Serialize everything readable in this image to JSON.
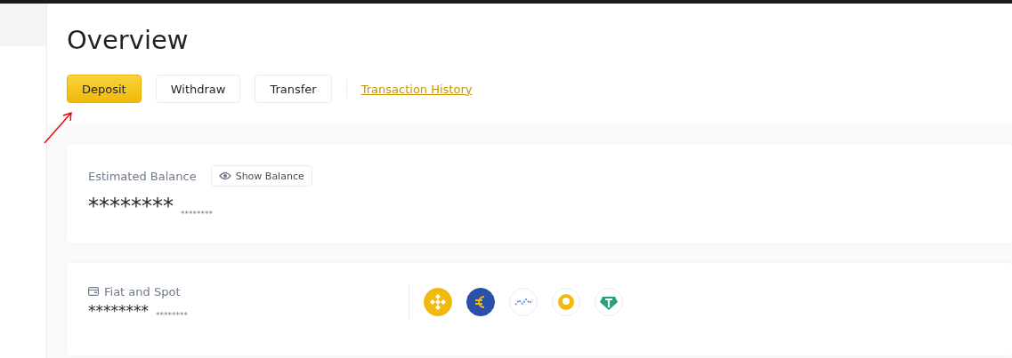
{
  "title": "Overview",
  "actions": [
    {
      "label": "Deposit",
      "kind": "primary"
    },
    {
      "label": "Withdraw",
      "kind": "secondary"
    },
    {
      "label": "Transfer",
      "kind": "secondary"
    },
    {
      "label": "Transaction History",
      "kind": "link"
    }
  ],
  "balance": {
    "label": "Estimated Balance",
    "toggle": "Show Balance",
    "amount": "********",
    "fiat": "********"
  },
  "wallet": {
    "label": "Fiat and Spot",
    "amount": "********",
    "fiat": "********"
  }
}
